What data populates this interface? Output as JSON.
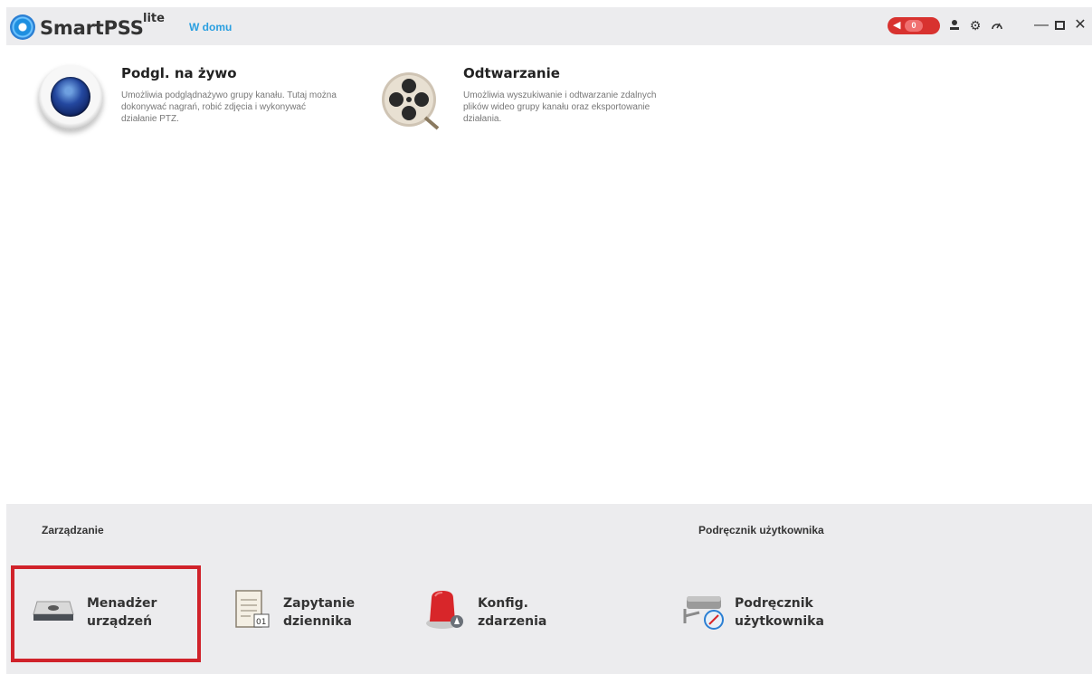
{
  "titlebar": {
    "app_name": "SmartPSS",
    "app_sup": "lite",
    "tab_home": "W domu",
    "alarm_count": "0",
    "icons": [
      "alarm-icon",
      "user-icon",
      "gear-icon",
      "speed-icon",
      "minimize-icon",
      "maximize-icon",
      "close-icon"
    ]
  },
  "features": {
    "live": {
      "title": "Podgl. na żywo",
      "desc": "Umożliwia podglądnażywo grupy kanału. Tutaj można dokonywać nagrań, robić zdjęcia i wykonywać działanie PTZ."
    },
    "playback": {
      "title": "Odtwarzanie",
      "desc": "Umożliwia wyszukiwanie i odtwarzanie zdalnych plików wideo grupy kanału oraz eksportowanie działania."
    }
  },
  "bottom": {
    "mgmt_label": "Zarządzanie",
    "manual_label": "Podręcznik użytkownika",
    "tools": {
      "device_manager": {
        "line1": "Menadżer",
        "line2": "urządzeń"
      },
      "log_query": {
        "line1": "Zapytanie",
        "line2": "dziennika"
      },
      "event_config": {
        "line1": "Konfig.",
        "line2": "zdarzenia"
      },
      "user_manual": {
        "line1": "Podręcznik",
        "line2": "użytkownika"
      }
    }
  },
  "colors": {
    "accent_blue": "#2a9fe0",
    "alarm_red": "#d8322f",
    "highlight_red": "#d0222a",
    "panel_gray": "#ececee"
  }
}
